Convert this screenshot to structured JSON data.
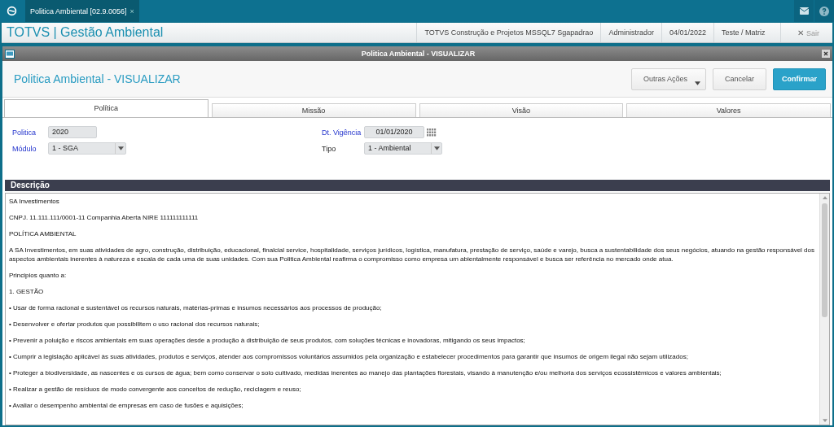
{
  "top_tabs": [
    {
      "label": "Politica Ambiental [02.9.0056]",
      "close": "×",
      "selected": true
    }
  ],
  "app_title": "TOTVS | Gestão Ambiental",
  "session": [
    "TOTVS Construção e Projetos MSSQL7 Sgapadrao",
    "Administrador",
    "04/01/2022",
    "Teste / Matriz"
  ],
  "exit": {
    "icon": "✕",
    "label": "Sair"
  },
  "dialog": {
    "title": "Politica Ambiental - VISUALIZAR",
    "heading": "Politica Ambiental - VISUALIZAR",
    "buttons": [
      {
        "label": "Outras Ações",
        "kind": "menu"
      },
      {
        "label": "Cancelar",
        "kind": "plain"
      },
      {
        "label": "Confirmar",
        "kind": "primary"
      }
    ]
  },
  "tabs": [
    {
      "label": "Política",
      "selected": true
    },
    {
      "label": "Missão",
      "selected": false
    },
    {
      "label": "Visão",
      "selected": false
    },
    {
      "label": "Valores",
      "selected": false
    }
  ],
  "fields_left": [
    {
      "label": "Politica",
      "value": "2020",
      "kind": "text",
      "required": true
    },
    {
      "label": "Módulo",
      "value": "1 - SGA",
      "kind": "select",
      "required": true
    }
  ],
  "fields_right": [
    {
      "label": "Dt. Vigência",
      "value": "01/01/2020",
      "kind": "date",
      "required": true
    },
    {
      "label": "Tipo",
      "value": "1 - Ambiental",
      "kind": "select",
      "required": false
    }
  ],
  "description": {
    "title": "Descrição",
    "paragraphs": [
      "SA Investimentos",
      "CNPJ. 11.111.111/0001-11 Companhia Aberta NIRE 111111111111",
      "POLÍTICA AMBIENTAL",
      "A SA Investimentos, em suas atividades de agro, construção, distribuição, educacional, finalcial service, hospitalidade, serviços jurídicos, logística, manufatura, prestação de serviço, saúde e varejo, busca a sustentabilidade dos seus negócios, atuando na gestão responsável dos aspectos ambientais inerentes à natureza e escala de cada uma de suas unidades. Com sua Politica Ambiental reafirma o compromisso como empresa  um  abientalmente responsável e busca ser referência no mercado onde atua.",
      "Principios quanto a:",
      "1. GESTÃO",
      "• Usar de forma racional e sustentável os recursos naturais, matérias-primas e insumos necessários aos processos de produção;",
      "• Desenvolver e ofertar produtos que possibilitem o uso racional dos recursos naturais;",
      "• Prevenir a poluição e riscos ambientais em suas operações desde a produção à  distribuição de seus produtos, com soluções técnicas e inovadoras, mitigando os seus impactos;",
      "• Cumprir a legislação aplicável às suas atividades, produtos e serviços, atender aos compromissos voluntários assumidos pela organização e estabelecer procedimentos para garantir que insumos de origem ilegal não sejam utilizados;",
      "• Proteger a biodiversidade, as nascentes e os cursos de água; bem como conservar o solo cultivado, medidas inerentes ao manejo das plantações florestais, visando à manutenção e/ou melhoria dos serviços ecossistêmicos e valores ambientais;",
      "• Realizar a gestão de resíduos de modo convergente aos conceitos de redução, reciclagem e reuso;",
      "• Avaliar o desempenho ambiental de empresas em caso de fusões e aquisições;"
    ]
  }
}
